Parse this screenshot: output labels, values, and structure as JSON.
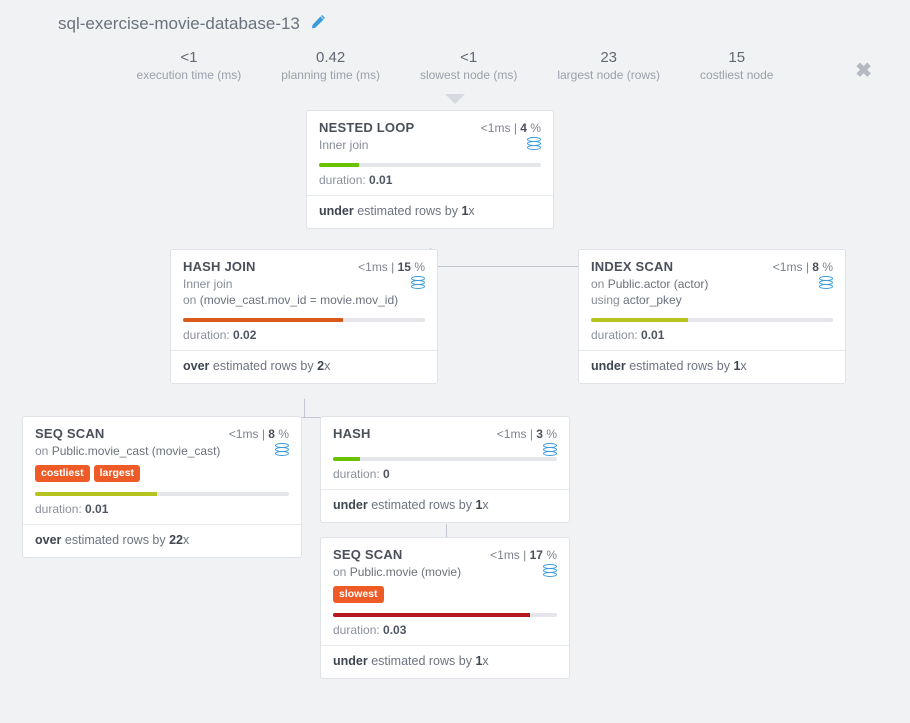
{
  "title": "sql-exercise-movie-database-13",
  "stats": {
    "execution_time": {
      "val": "<1",
      "label": "execution time (ms)"
    },
    "planning_time": {
      "val": "0.42",
      "label": "planning time (ms)"
    },
    "slowest_node": {
      "val": "<1",
      "label": "slowest node (ms)"
    },
    "largest_node": {
      "val": "23",
      "label": "largest node (rows)"
    },
    "costliest_node": {
      "val": "15",
      "label": "costliest node"
    }
  },
  "nodes": {
    "nested_loop": {
      "name": "NESTED LOOP",
      "time": "<1",
      "pct": "4",
      "sub": "Inner join",
      "bar_w": "18%",
      "bar_c": "bar-green",
      "duration": "0.01",
      "est_dir": "under",
      "est_x": "1"
    },
    "hash_join": {
      "name": "HASH JOIN",
      "time": "<1",
      "pct": "15",
      "sub_prefix": "Inner join",
      "sub_on_1": "on",
      "sub_on_2": "(movie_cast.mov_id = movie.mov_id)",
      "bar_w": "66%",
      "bar_c": "bar-orange",
      "duration": "0.02",
      "est_dir": "over",
      "est_x": "2"
    },
    "index_scan": {
      "name": "INDEX SCAN",
      "time": "<1",
      "pct": "8",
      "sub_on": "on",
      "sub_tbl": "Public.actor (actor)",
      "sub_using": "using",
      "sub_idx": "actor_pkey",
      "bar_w": "40%",
      "bar_c": "bar-olive",
      "duration": "0.01",
      "est_dir": "under",
      "est_x": "1"
    },
    "seq_scan_mc": {
      "name": "SEQ SCAN",
      "time": "<1",
      "pct": "8",
      "sub_on": "on",
      "sub_tbl": "Public.movie_cast (movie_cast)",
      "tag1": "costliest",
      "tag2": "largest",
      "bar_w": "48%",
      "bar_c": "bar-olive",
      "duration": "0.01",
      "est_dir": "over",
      "est_x": "22"
    },
    "hash": {
      "name": "HASH",
      "time": "<1",
      "pct": "3",
      "bar_w": "12%",
      "bar_c": "bar-green",
      "duration": "0",
      "est_dir": "under",
      "est_x": "1"
    },
    "seq_scan_mv": {
      "name": "SEQ SCAN",
      "time": "<1",
      "pct": "17",
      "sub_on": "on",
      "sub_tbl": "Public.movie (movie)",
      "tag1": "slowest",
      "bar_w": "88%",
      "bar_c": "bar-crimson",
      "duration": "0.03",
      "est_dir": "under",
      "est_x": "1"
    }
  },
  "labels": {
    "duration": "duration:",
    "estimated_rows_by": "estimated rows by",
    "x_suffix": "x",
    "ms_suffix": "ms",
    "pct_suffix": "%",
    "pipe": "|"
  }
}
